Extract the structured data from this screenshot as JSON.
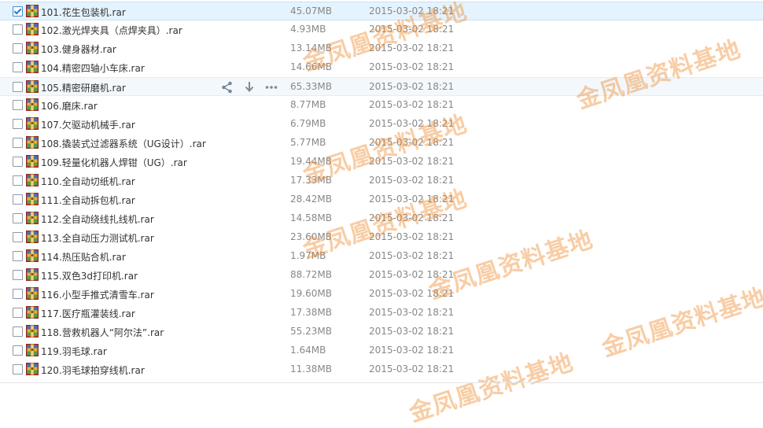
{
  "files": [
    {
      "name": "101.花生包装机.rar",
      "size": "45.07MB",
      "date": "2015-03-02 18:21",
      "checked": true,
      "state": "selected"
    },
    {
      "name": "102.激光焊夹具（点焊夹具）.rar",
      "size": "4.93MB",
      "date": "2015-03-02 18:21",
      "checked": false,
      "state": ""
    },
    {
      "name": "103.健身器材.rar",
      "size": "13.14MB",
      "date": "2015-03-02 18:21",
      "checked": false,
      "state": ""
    },
    {
      "name": "104.精密四轴小车床.rar",
      "size": "14.66MB",
      "date": "2015-03-02 18:21",
      "checked": false,
      "state": ""
    },
    {
      "name": "105.精密研磨机.rar",
      "size": "65.33MB",
      "date": "2015-03-02 18:21",
      "checked": false,
      "state": "hover"
    },
    {
      "name": "106.磨床.rar",
      "size": "8.77MB",
      "date": "2015-03-02 18:21",
      "checked": false,
      "state": ""
    },
    {
      "name": "107.欠驱动机械手.rar",
      "size": "6.79MB",
      "date": "2015-03-02 18:21",
      "checked": false,
      "state": ""
    },
    {
      "name": "108.撬装式过滤器系统（UG设计）.rar",
      "size": "5.77MB",
      "date": "2015-03-02 18:21",
      "checked": false,
      "state": ""
    },
    {
      "name": "109.轻量化机器人焊钳（UG）.rar",
      "size": "19.44MB",
      "date": "2015-03-02 18:21",
      "checked": false,
      "state": ""
    },
    {
      "name": "110.全自动切纸机.rar",
      "size": "17.33MB",
      "date": "2015-03-02 18:21",
      "checked": false,
      "state": ""
    },
    {
      "name": "111.全自动拆包机.rar",
      "size": "28.42MB",
      "date": "2015-03-02 18:21",
      "checked": false,
      "state": ""
    },
    {
      "name": "112.全自动绕线扎线机.rar",
      "size": "14.58MB",
      "date": "2015-03-02 18:21",
      "checked": false,
      "state": ""
    },
    {
      "name": "113.全自动压力测试机.rar",
      "size": "23.60MB",
      "date": "2015-03-02 18:21",
      "checked": false,
      "state": ""
    },
    {
      "name": "114.热压贴合机.rar",
      "size": "1.97MB",
      "date": "2015-03-02 18:21",
      "checked": false,
      "state": ""
    },
    {
      "name": "115.双色3d打印机.rar",
      "size": "88.72MB",
      "date": "2015-03-02 18:21",
      "checked": false,
      "state": ""
    },
    {
      "name": "116.小型手推式清雪车.rar",
      "size": "19.60MB",
      "date": "2015-03-02 18:21",
      "checked": false,
      "state": ""
    },
    {
      "name": "117.医疗瓶灌装线.rar",
      "size": "17.38MB",
      "date": "2015-03-02 18:21",
      "checked": false,
      "state": ""
    },
    {
      "name": "118.营救机器人“阿尔法”.rar",
      "size": "55.23MB",
      "date": "2015-03-02 18:21",
      "checked": false,
      "state": ""
    },
    {
      "name": "119.羽毛球.rar",
      "size": "1.64MB",
      "date": "2015-03-02 18:21",
      "checked": false,
      "state": ""
    },
    {
      "name": "120.羽毛球拍穿线机.rar",
      "size": "11.38MB",
      "date": "2015-03-02 18:21",
      "checked": false,
      "state": ""
    }
  ],
  "hover_actions": [
    "share-icon",
    "download-icon",
    "more-icon"
  ],
  "watermark_text": "金凤凰资料基地",
  "colors": {
    "watermark": "#f08a2a",
    "selected_row": "#e5f3fe",
    "hover_row": "#f3f8fd",
    "meta_text": "#888888",
    "name_text": "#333333"
  }
}
